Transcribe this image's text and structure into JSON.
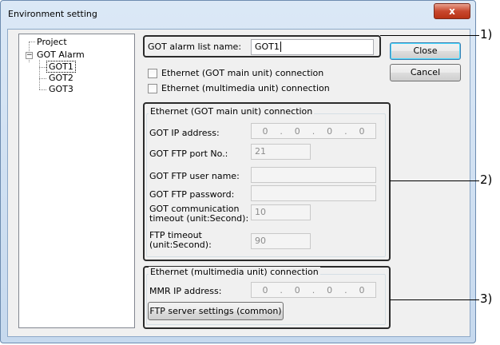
{
  "window": {
    "title": "Environment setting",
    "close_glyph": "x"
  },
  "tree": {
    "items": [
      {
        "label": "Project"
      },
      {
        "label": "GOT Alarm",
        "expander": "−"
      },
      {
        "label": "GOT1",
        "selected": true
      },
      {
        "label": "GOT2"
      },
      {
        "label": "GOT3"
      }
    ]
  },
  "alarm_list": {
    "label": "GOT alarm list name:",
    "value": "GOT1"
  },
  "checkboxes": [
    {
      "label": "Ethernet (GOT main unit) connection",
      "checked": false
    },
    {
      "label": "Ethernet (multimedia unit) connection",
      "checked": false
    }
  ],
  "got_main": {
    "title": "Ethernet (GOT main unit) connection",
    "ip_label": "GOT IP address:",
    "ip_octets": [
      "0",
      "0",
      "0",
      "0"
    ],
    "ip_dot": ".",
    "ftp_port_label": "GOT FTP port No.:",
    "ftp_port_value": "21",
    "ftp_user_label": "GOT FTP user name:",
    "ftp_user_value": "",
    "ftp_password_label": "GOT FTP password:",
    "ftp_password_value": "",
    "comm_timeout_label_1": "GOT communication",
    "comm_timeout_label_2": "timeout (unit:Second):",
    "comm_timeout_value": "10",
    "ftp_timeout_label_1": "FTP timeout",
    "ftp_timeout_label_2": "(unit:Second):",
    "ftp_timeout_value": "90"
  },
  "multimedia": {
    "title": "Ethernet (multimedia unit) connection",
    "ip_label": "MMR IP address:",
    "ip_octets": [
      "0",
      "0",
      "0",
      "0"
    ],
    "ip_dot": ".",
    "ftp_server_button": "FTP server settings (common)"
  },
  "buttons": {
    "close": "Close",
    "cancel": "Cancel"
  },
  "callouts": [
    "1)",
    "2)",
    "3)"
  ]
}
